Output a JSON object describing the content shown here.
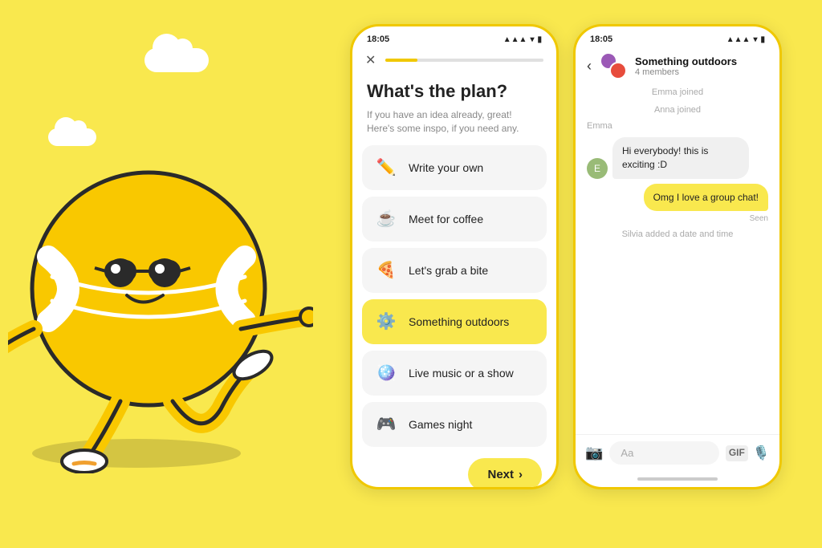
{
  "background_color": "#F9E84E",
  "phone1": {
    "status_time": "18:05",
    "title": "What's the plan?",
    "subtitle": "If you have an idea already, great!\nHere's some inspo, if you need any.",
    "options": [
      {
        "id": "write",
        "label": "Write your own",
        "icon": "✏️",
        "selected": false
      },
      {
        "id": "coffee",
        "label": "Meet for coffee",
        "icon": "☕",
        "selected": false
      },
      {
        "id": "bite",
        "label": "Let's grab a bite",
        "icon": "🍕",
        "selected": false
      },
      {
        "id": "outdoors",
        "label": "Something outdoors",
        "icon": "⚙️",
        "selected": true
      },
      {
        "id": "music",
        "label": "Live music or a show",
        "icon": "🪩",
        "selected": false
      },
      {
        "id": "games",
        "label": "Games night",
        "icon": "🎮",
        "selected": false
      }
    ],
    "next_button": "Next"
  },
  "phone2": {
    "status_time": "18:05",
    "chat_name": "Something outdoors",
    "chat_members": "4 members",
    "system_messages": [
      "Emma joined",
      "Anna joined"
    ],
    "sender_label": "Emma",
    "messages": [
      {
        "id": 1,
        "type": "other",
        "text": "Hi everybody! this is exciting :D",
        "seen": false
      },
      {
        "id": 2,
        "type": "mine",
        "text": "Omg I love a group chat!",
        "seen": true
      }
    ],
    "system_message_2": "Silvia added a date and time",
    "input_placeholder": "Aa"
  }
}
